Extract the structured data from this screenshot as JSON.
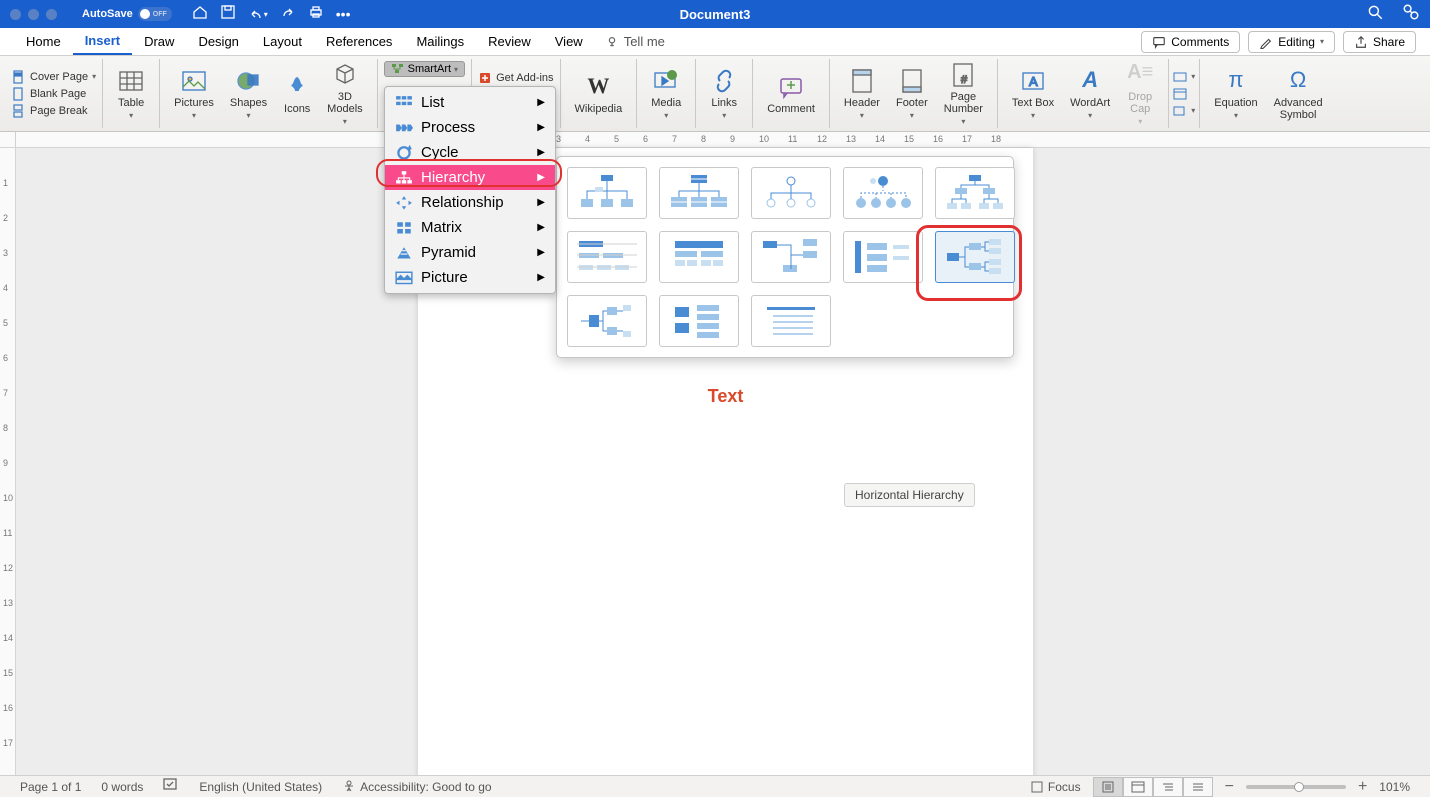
{
  "title_bar": {
    "autosave_label": "AutoSave",
    "autosave_state": "OFF",
    "document_title": "Document3"
  },
  "tabs": {
    "items": [
      "Home",
      "Insert",
      "Draw",
      "Design",
      "Layout",
      "References",
      "Mailings",
      "Review",
      "View"
    ],
    "active": "Insert",
    "tell_me": "Tell me"
  },
  "actions": {
    "comments": "Comments",
    "editing": "Editing",
    "share": "Share"
  },
  "ribbon": {
    "pages": {
      "cover": "Cover Page",
      "blank": "Blank Page",
      "break": "Page Break"
    },
    "table": "Table",
    "pictures": "Pictures",
    "shapes": "Shapes",
    "icons": "Icons",
    "models": "3D\nModels",
    "smartart": "SmartArt",
    "addins": "Get Add-ins",
    "myaddins": "Add-ins",
    "wikipedia": "Wikipedia",
    "media": "Media",
    "links": "Links",
    "comment": "Comment",
    "header": "Header",
    "footer": "Footer",
    "pagenum": "Page\nNumber",
    "textbox": "Text Box",
    "wordart": "WordArt",
    "dropcap": "Drop\nCap",
    "equation": "Equation",
    "symbol": "Advanced\nSymbol"
  },
  "smartart_menu": {
    "items": [
      "List",
      "Process",
      "Cycle",
      "Hierarchy",
      "Relationship",
      "Matrix",
      "Pyramid",
      "Picture"
    ],
    "selected": "Hierarchy"
  },
  "tooltip": "Horizontal Hierarchy",
  "page_content": {
    "main_text": "Text"
  },
  "status": {
    "page": "Page 1 of 1",
    "words": "0 words",
    "language": "English (United States)",
    "accessibility": "Accessibility: Good to go",
    "focus": "Focus",
    "zoom": "101%"
  },
  "ruler": {
    "horizontal": [
      "3",
      "4",
      "5",
      "6",
      "7",
      "8",
      "9",
      "10",
      "11",
      "12",
      "13",
      "14",
      "15",
      "16",
      "17",
      "18"
    ]
  }
}
